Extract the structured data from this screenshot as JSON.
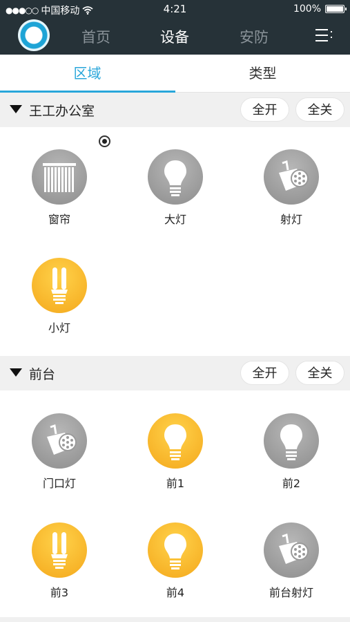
{
  "status_bar": {
    "signal_dots": "●●●○○",
    "carrier": "中国移动",
    "wifi_icon": "wifi-icon",
    "time": "4:21",
    "battery_percent": "100%"
  },
  "nav": {
    "items": [
      {
        "label": "首页",
        "active": false
      },
      {
        "label": "设备",
        "active": true
      },
      {
        "label": "安防",
        "active": false
      }
    ],
    "menu_icon": "menu-icon",
    "accent": "#28a6da",
    "bar_color": "#263238"
  },
  "tabs": [
    {
      "label": "区域",
      "active": true
    },
    {
      "label": "类型",
      "active": false
    }
  ],
  "sections": [
    {
      "title": "王工办公室",
      "all_on_label": "全开",
      "all_off_label": "全关",
      "devices": [
        {
          "label": "窗帘",
          "icon": "curtain-icon",
          "state": "off"
        },
        {
          "label": "大灯",
          "icon": "bulb-icon",
          "state": "off"
        },
        {
          "label": "射灯",
          "icon": "spotlight-icon",
          "state": "off"
        },
        {
          "label": "小灯",
          "icon": "cfl-bulb-icon",
          "state": "on"
        }
      ]
    },
    {
      "title": "前台",
      "all_on_label": "全开",
      "all_off_label": "全关",
      "devices": [
        {
          "label": "门口灯",
          "icon": "spotlight-icon",
          "state": "off"
        },
        {
          "label": "前1",
          "icon": "bulb-icon",
          "state": "on"
        },
        {
          "label": "前2",
          "icon": "bulb-icon",
          "state": "off"
        },
        {
          "label": "前3",
          "icon": "cfl-bulb-icon",
          "state": "on"
        },
        {
          "label": "前4",
          "icon": "bulb-icon",
          "state": "on"
        },
        {
          "label": "前台射灯",
          "icon": "spotlight-icon",
          "state": "off"
        }
      ]
    }
  ],
  "colors": {
    "on": "#f4a81c",
    "off": "#9a9a9a"
  }
}
